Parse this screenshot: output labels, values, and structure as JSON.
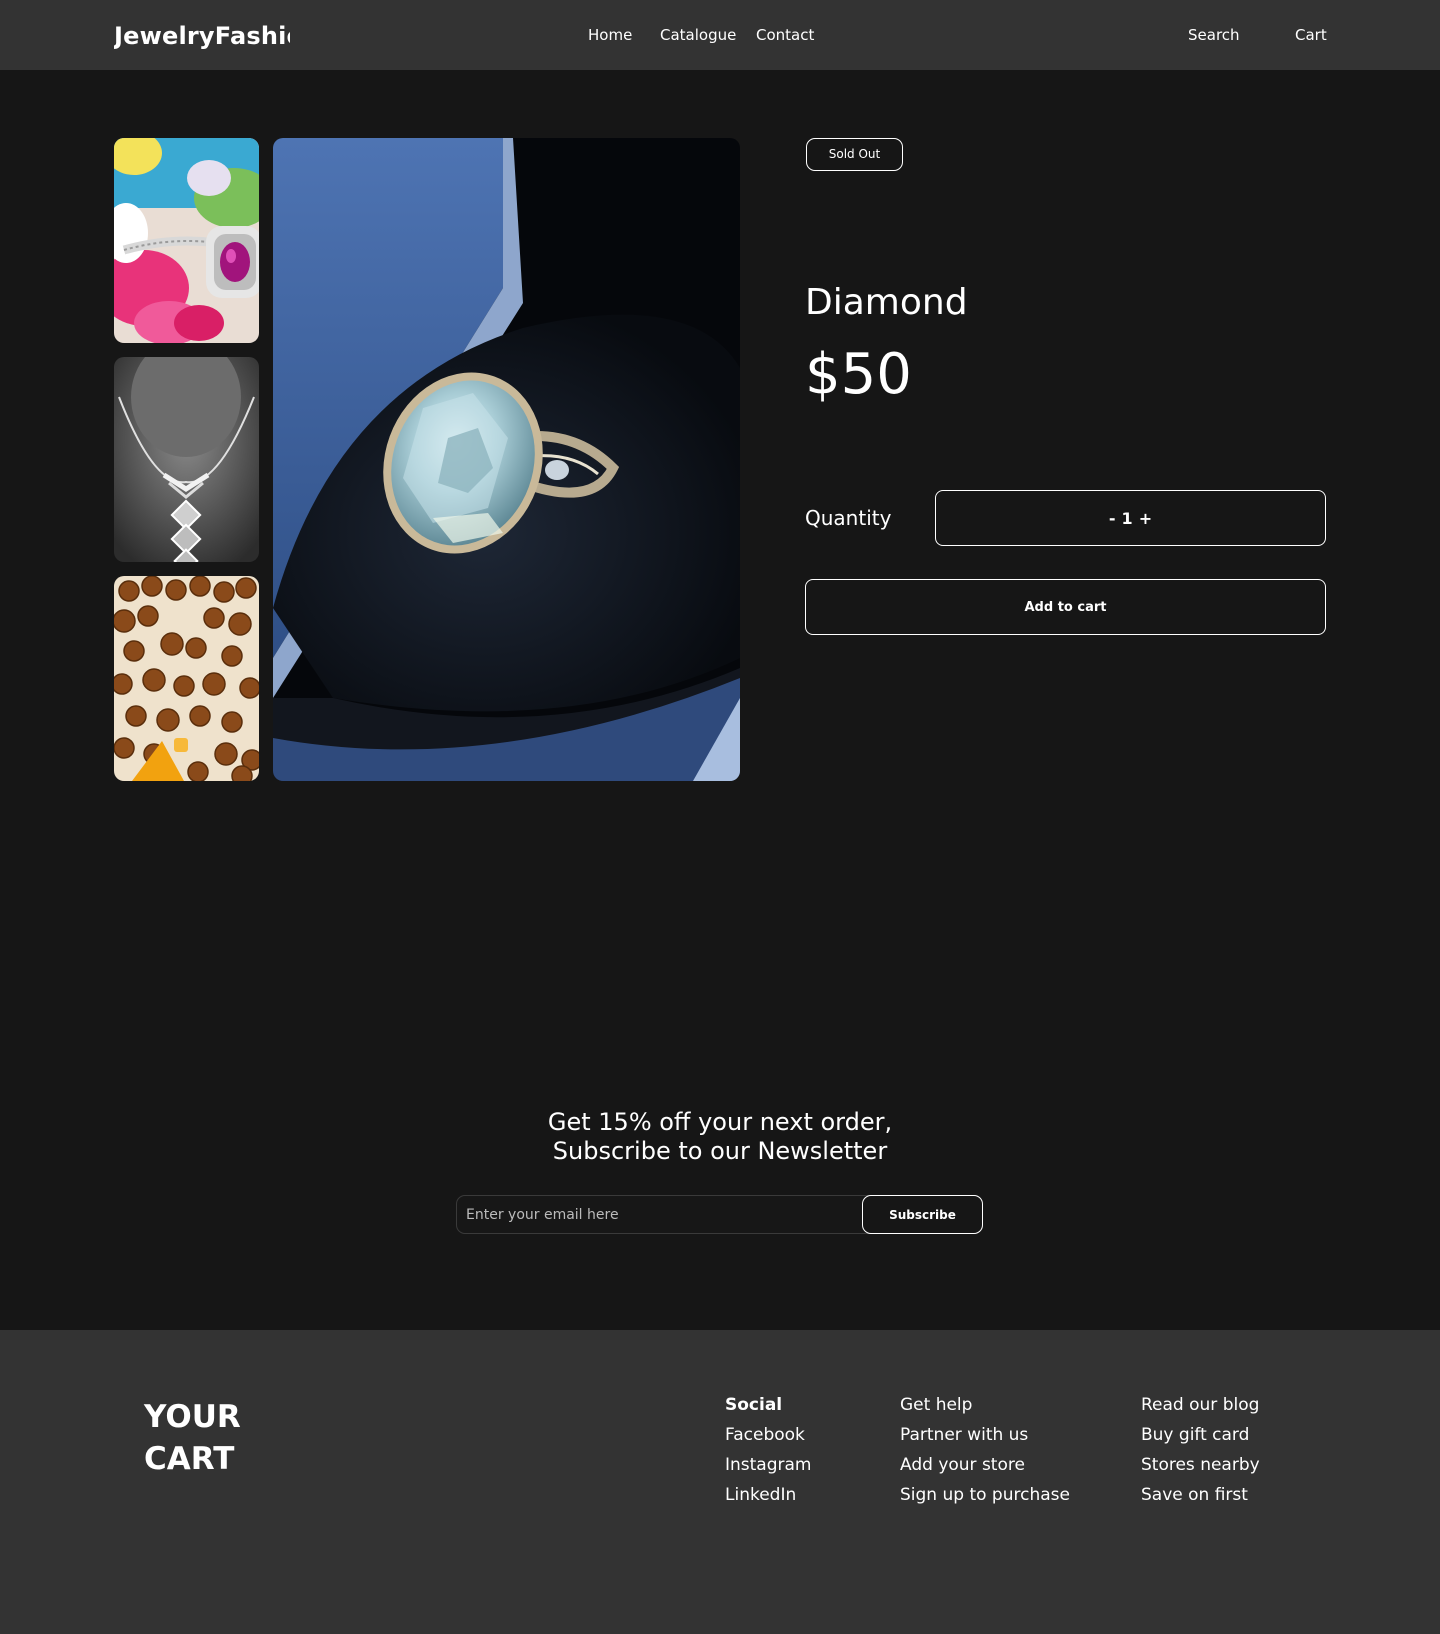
{
  "header": {
    "logo": "JewelryFashion",
    "nav": {
      "home": "Home",
      "catalogue": "Catalogue",
      "contact": "Contact",
      "search": "Search",
      "cart": "Cart"
    }
  },
  "product": {
    "badge": "Sold Out",
    "name": "Diamond",
    "price": "$50",
    "quantity_label": "Quantity",
    "quantity": {
      "minus": "-",
      "value": "1",
      "plus": "+"
    },
    "add_to_cart": "Add to cart"
  },
  "newsletter": {
    "line1": "Get 15% off your next order,",
    "line2": "Subscribe to our Newsletter",
    "email_placeholder": "Enter your email here",
    "subscribe": "Subscribe"
  },
  "footer": {
    "brand_line1": "YOUR",
    "brand_line2": "CART",
    "col1": [
      "Social",
      "Facebook",
      "Instagram",
      "LinkedIn"
    ],
    "col2": [
      "Get help",
      "Partner with us",
      "Add your store",
      "Sign up to purchase"
    ],
    "col3": [
      "Read our blog",
      "Buy gift card",
      "Stores nearby",
      "Save on first"
    ]
  },
  "colors": {
    "background": "#161616",
    "header": "#333333",
    "footer": "#333333",
    "text": "#ffffff"
  }
}
